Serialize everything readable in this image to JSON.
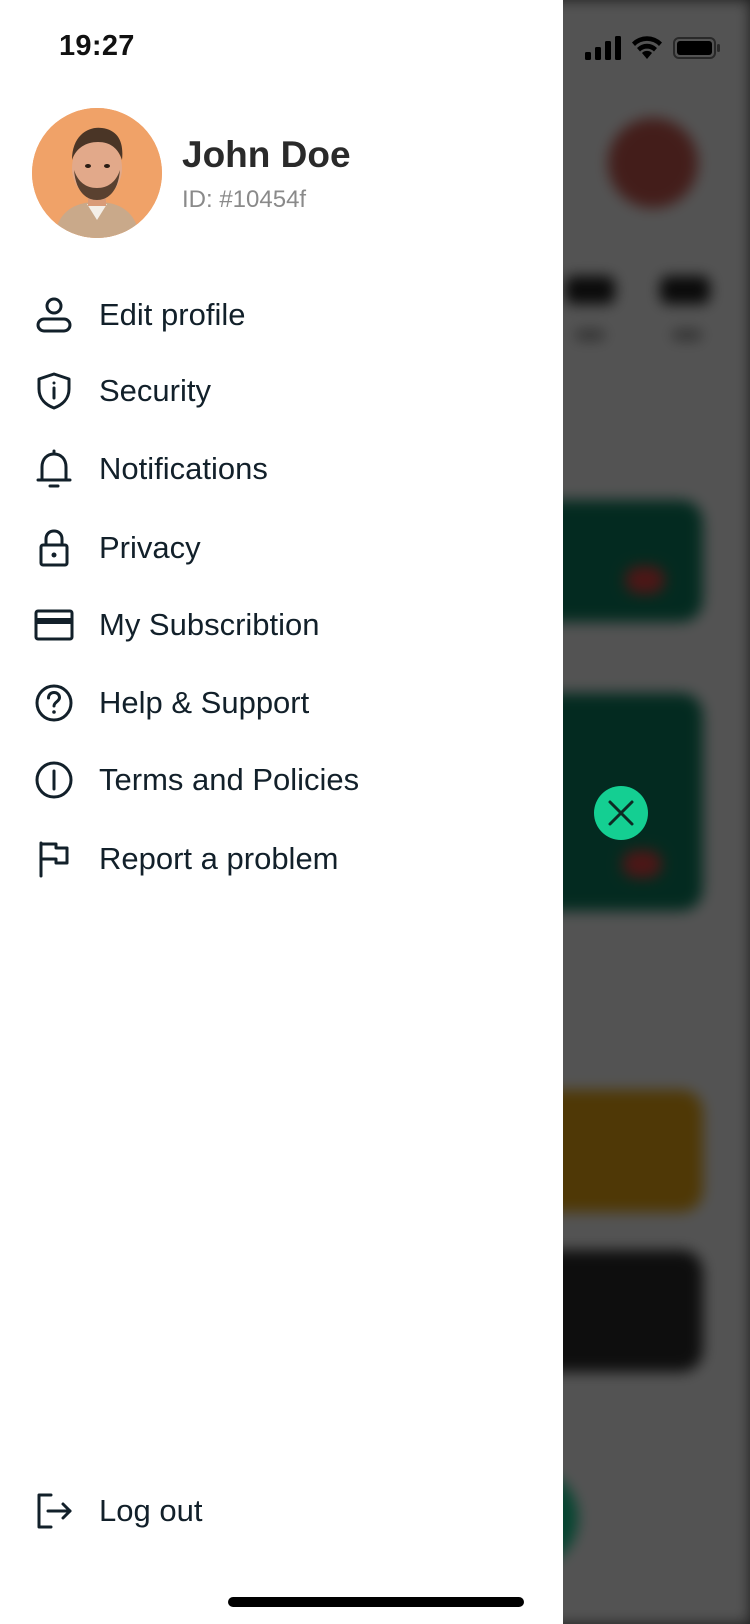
{
  "status_bar": {
    "time": "19:27"
  },
  "user": {
    "name": "John Doe",
    "id": "ID: #10454f"
  },
  "menu": {
    "items": [
      {
        "label": "Edit profile",
        "icon": "user-icon"
      },
      {
        "label": "Security",
        "icon": "shield-icon"
      },
      {
        "label": "Notifications",
        "icon": "bell-icon"
      },
      {
        "label": "Privacy",
        "icon": "lock-icon"
      },
      {
        "label": "My Subscribtion",
        "icon": "credit-card-icon"
      },
      {
        "label": "Help & Support",
        "icon": "help-circle-icon"
      },
      {
        "label": "Terms and Policies",
        "icon": "info-circle-icon"
      },
      {
        "label": "Report a problem",
        "icon": "flag-icon"
      }
    ],
    "logout": {
      "label": "Log out",
      "icon": "logout-icon"
    }
  },
  "colors": {
    "accent": "#14cf92",
    "text": "#12202a",
    "muted": "#8a8a8a",
    "background_card_green": "#0b7d5e",
    "background_card_yellow": "#e7a412"
  }
}
